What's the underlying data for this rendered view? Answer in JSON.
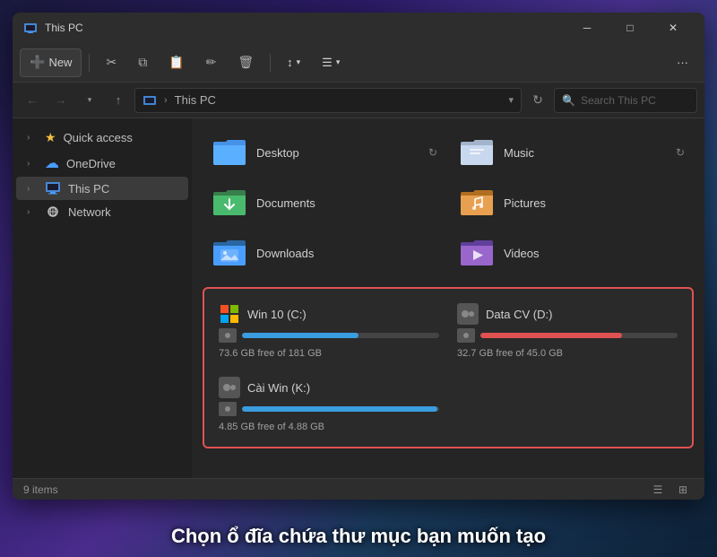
{
  "window": {
    "title": "This PC",
    "title_icon": "computer"
  },
  "title_bar": {
    "title": "This PC",
    "minimize_label": "─",
    "maximize_label": "□",
    "close_label": "✕"
  },
  "toolbar": {
    "new_label": "New",
    "new_icon": "➕",
    "cut_icon": "✂",
    "copy_icon": "⧉",
    "paste_icon": "📋",
    "rename_icon": "✏",
    "delete_icon": "🗑",
    "sort_label": "↕",
    "view_label": "☰",
    "more_label": "···"
  },
  "address_bar": {
    "back_icon": "←",
    "forward_icon": "→",
    "up_icon": "↑",
    "path_root": "This PC",
    "refresh_icon": "↻",
    "search_placeholder": "Search This PC",
    "search_icon": "🔍"
  },
  "sidebar": {
    "items": [
      {
        "label": "Quick access",
        "icon": "star",
        "chevron": "›",
        "id": "quick-access"
      },
      {
        "label": "OneDrive",
        "icon": "cloud",
        "chevron": "›",
        "id": "onedrive"
      },
      {
        "label": "This PC",
        "icon": "computer",
        "chevron": "›",
        "id": "this-pc",
        "active": true
      },
      {
        "label": "Network",
        "icon": "network",
        "chevron": "›",
        "id": "network"
      }
    ]
  },
  "folders": [
    {
      "name": "Desktop",
      "icon": "desktop",
      "color": "#4a9eff",
      "has_refresh": true
    },
    {
      "name": "Documents",
      "icon": "documents",
      "color": "#b0c4de",
      "has_refresh": true
    },
    {
      "name": "Downloads",
      "icon": "downloads",
      "color": "#4aba6e",
      "has_refresh": false
    },
    {
      "name": "Music",
      "icon": "music",
      "color": "#e8a050",
      "has_refresh": false
    },
    {
      "name": "Pictures",
      "icon": "pictures",
      "color": "#4a9eff",
      "has_refresh": false
    },
    {
      "name": "Videos",
      "icon": "videos",
      "color": "#9966cc",
      "has_refresh": false
    }
  ],
  "drives": [
    {
      "name": "Win 10 (C:)",
      "icon": "windows",
      "free_label": "73.6 GB free of 181 GB",
      "fill_pct": 59,
      "bar_color": "blue"
    },
    {
      "name": "Data CV (D:)",
      "icon": "hdd",
      "free_label": "32.7 GB free of 45.0 GB",
      "fill_pct": 72,
      "bar_color": "red"
    },
    {
      "name": "Cài Win (K:)",
      "icon": "hdd",
      "free_label": "4.85 GB free of 4.88 GB",
      "fill_pct": 99,
      "bar_color": "blue"
    }
  ],
  "status_bar": {
    "item_count": "9 items"
  },
  "overlay_text": "Chọn ổ đĩa chứa thư mục bạn muốn tạo"
}
